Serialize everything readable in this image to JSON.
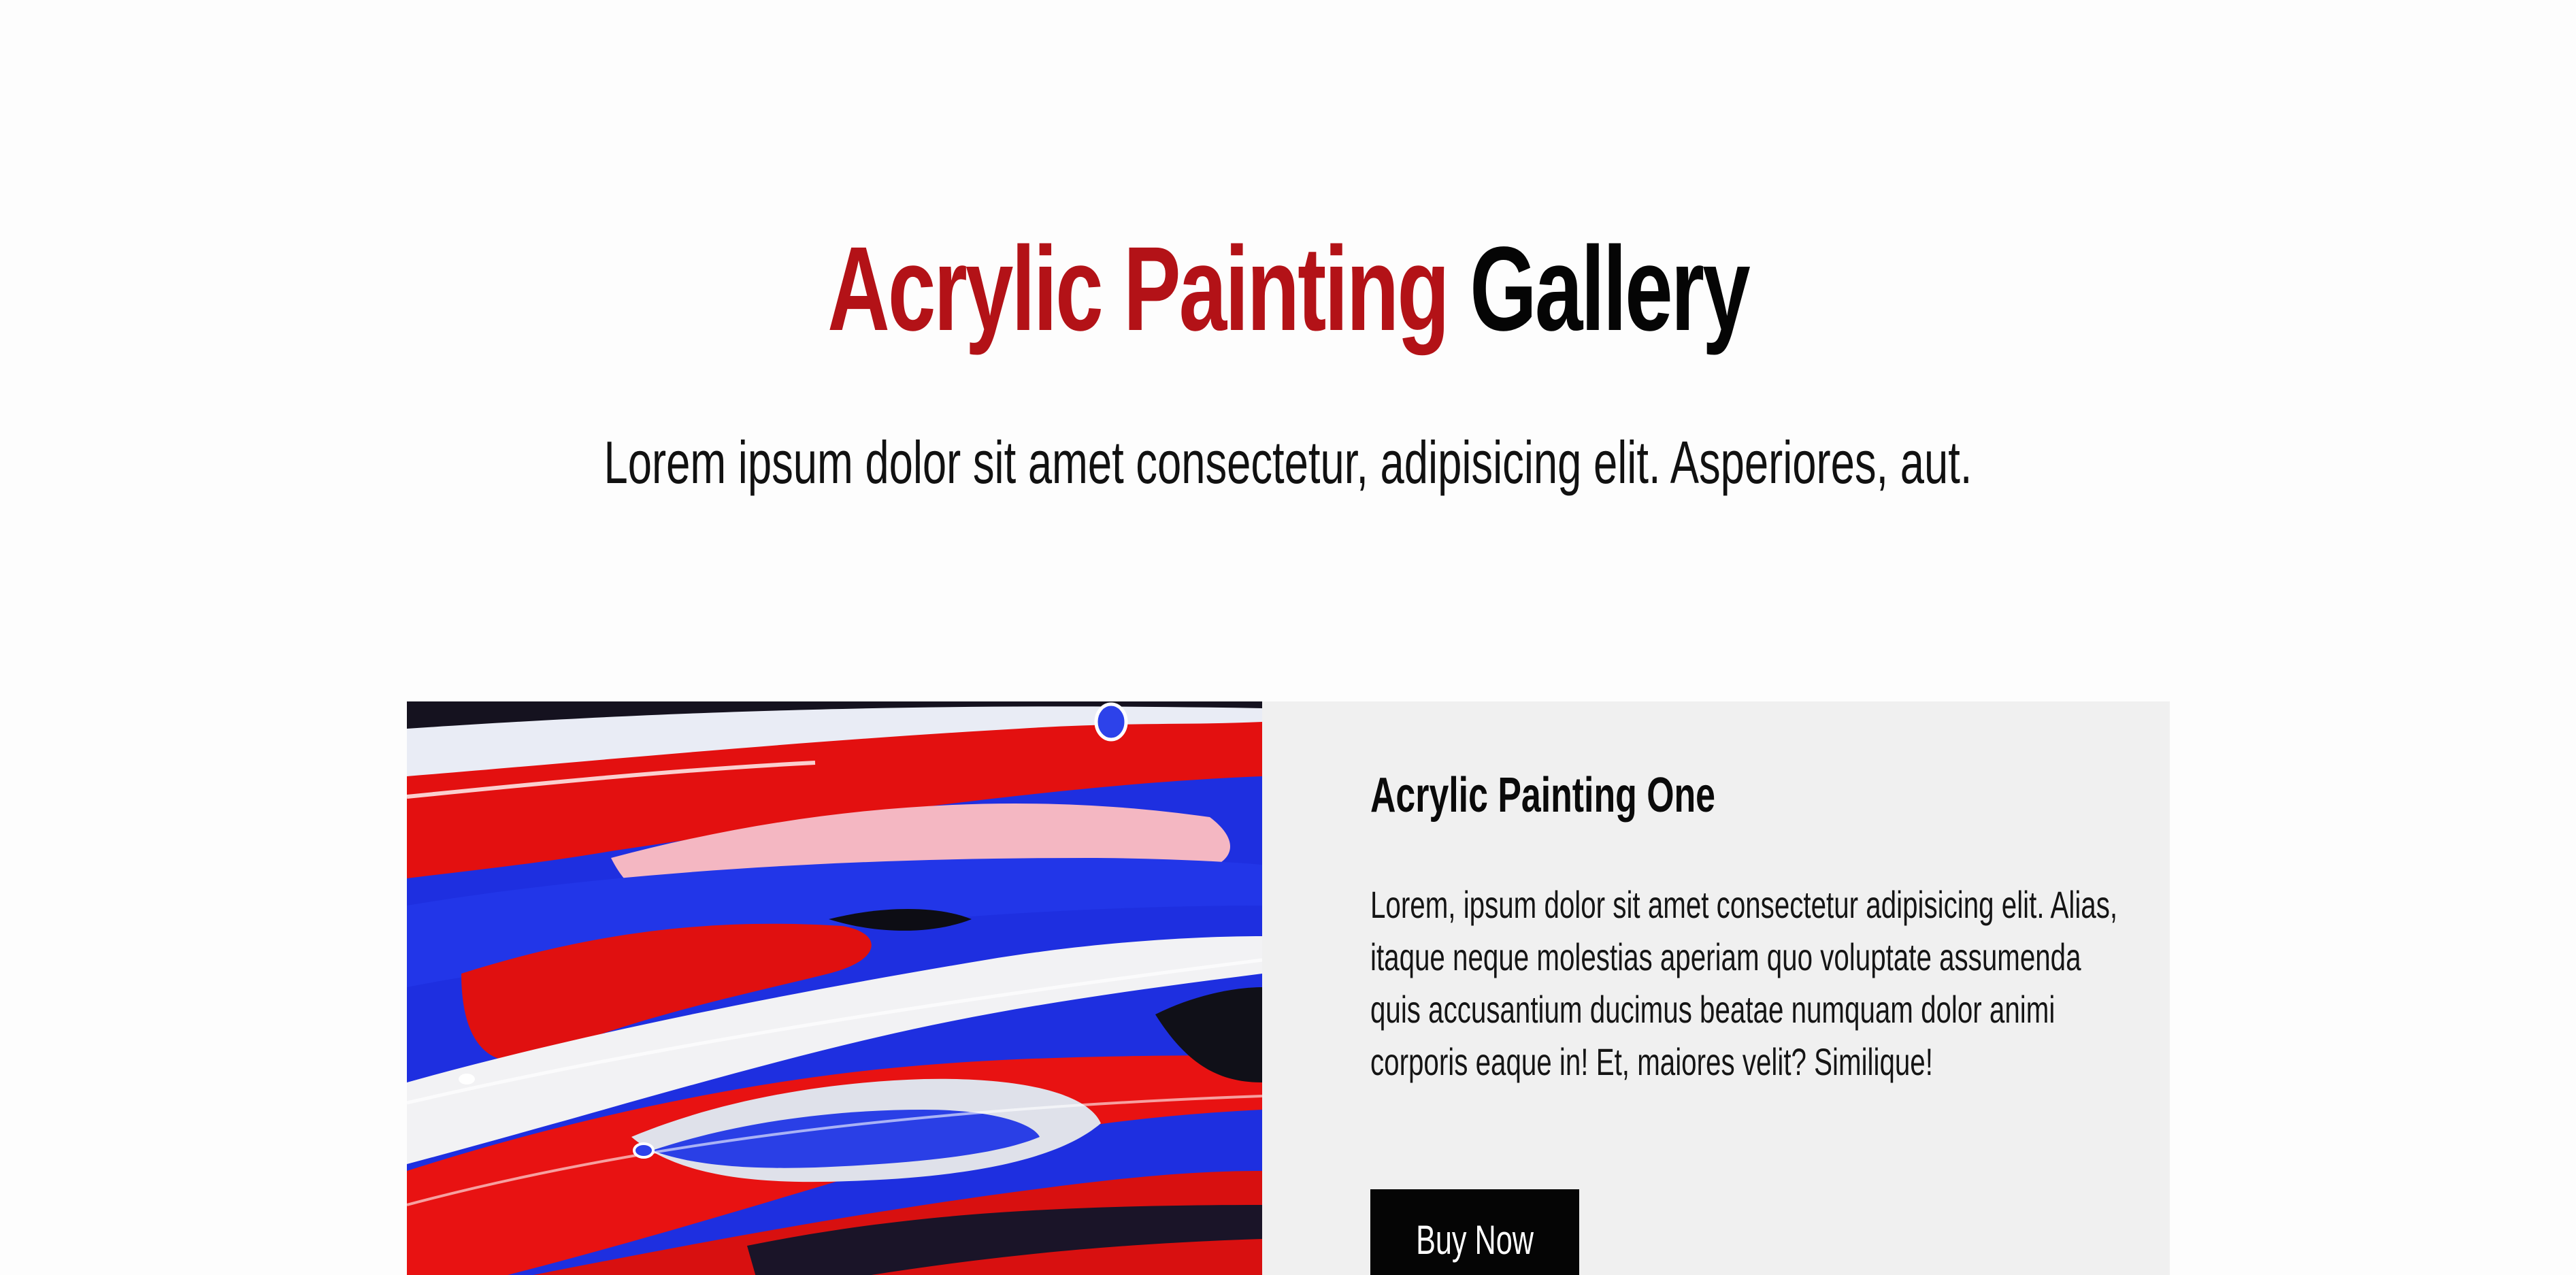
{
  "header": {
    "title_accent": "Acrylic Painting",
    "title_rest": "Gallery",
    "subtitle": "Lorem ipsum dolor sit amet consectetur, adipisicing elit. Asperiores, aut."
  },
  "card": {
    "title": "Acrylic Painting One",
    "text": "Lorem, ipsum dolor sit amet consectetur adipisicing elit. Alias, itaque neque molestias aperiam quo voluptate assumenda quis accusantium ducimus beatae numquam dolor animi corporis eaque in! Et, maiores velit? Similique!",
    "button_label": "Buy Now"
  },
  "colors": {
    "accent": "#b31217",
    "card_background": "#f0f0f0",
    "button_background": "#050505"
  }
}
